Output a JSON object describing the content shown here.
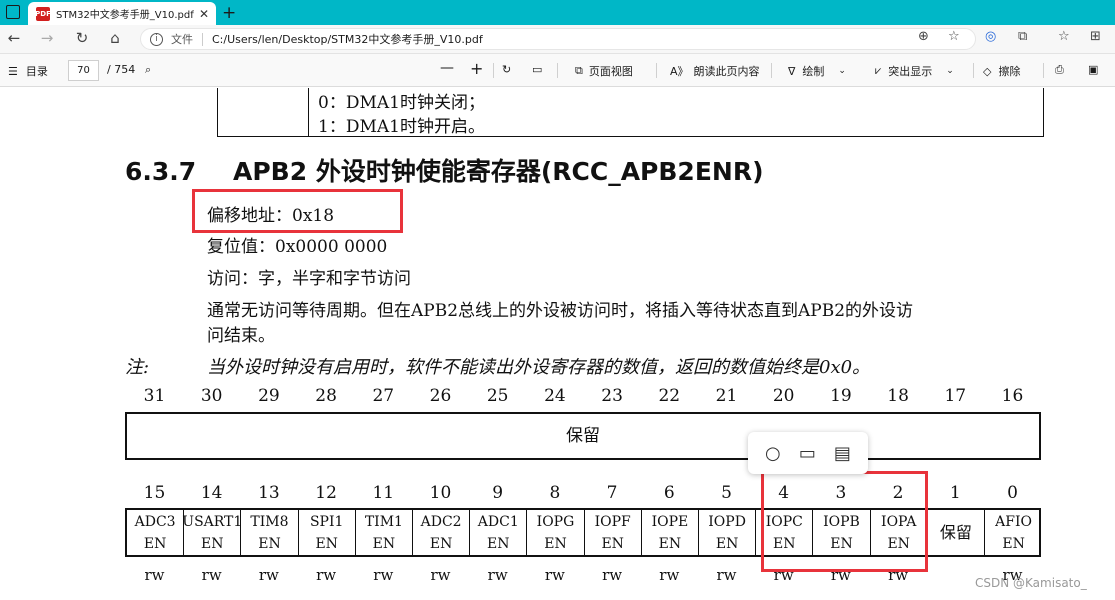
{
  "browser": {
    "tab_title": "STM32中文参考手册_V10.pdf",
    "tab_close": "✕",
    "new_tab": "+",
    "protocol_label": "文件",
    "url": "C:/Users/len/Desktop/STM32中文参考手册_V10.pdf"
  },
  "pdf_toolbar": {
    "toc_label": "目录",
    "page_current": "70",
    "page_total": "/ 754",
    "page_view_label": "页面视图",
    "read_aloud_label": "朗读此页内容",
    "draw_label": "绘制",
    "highlight_label": "突出显示",
    "erase_label": "擦除"
  },
  "document": {
    "prev_table_rows": [
      "0：DMA1时钟关闭；",
      "1：DMA1时钟开启。"
    ],
    "section_number": "6.3.7",
    "section_title": "APB2 外设时钟使能寄存器(RCC_APB2ENR)",
    "offset_line": "偏移地址：0x18",
    "reset_line": "复位值：0x0000 0000",
    "access_line": "访问：字，半字和字节访问",
    "wait_line_1": "通常无访问等待周期。但在APB2总线上的外设被访问时，将插入等待状态直到APB2的外设访",
    "wait_line_2": "问结束。",
    "note_label": "注:",
    "note_text": "当外设时钟没有启用时，软件不能读出外设寄存器的数值，返回的数值始终是0x0。"
  },
  "register": {
    "upper_bits": [
      "31",
      "30",
      "29",
      "28",
      "27",
      "26",
      "25",
      "24",
      "23",
      "22",
      "21",
      "20",
      "19",
      "18",
      "17",
      "16"
    ],
    "upper_field": "保留",
    "lower_bits": [
      "15",
      "14",
      "13",
      "12",
      "11",
      "10",
      "9",
      "8",
      "7",
      "6",
      "5",
      "4",
      "3",
      "2",
      "1",
      "0"
    ],
    "lower_fields": [
      {
        "l1": "ADC3",
        "l2": "EN"
      },
      {
        "l1": "USART1",
        "l2": "EN"
      },
      {
        "l1": "TIM8",
        "l2": "EN"
      },
      {
        "l1": "SPI1",
        "l2": "EN"
      },
      {
        "l1": "TIM1",
        "l2": "EN"
      },
      {
        "l1": "ADC2",
        "l2": "EN"
      },
      {
        "l1": "ADC1",
        "l2": "EN"
      },
      {
        "l1": "IOPG",
        "l2": "EN"
      },
      {
        "l1": "IOPF",
        "l2": "EN"
      },
      {
        "l1": "IOPE",
        "l2": "EN"
      },
      {
        "l1": "IOPD",
        "l2": "EN"
      },
      {
        "l1": "IOPC",
        "l2": "EN"
      },
      {
        "l1": "IOPB",
        "l2": "EN"
      },
      {
        "l1": "IOPA",
        "l2": "EN"
      },
      {
        "l1": "保留",
        "l2": ""
      },
      {
        "l1": "AFIO",
        "l2": "EN"
      }
    ],
    "access": [
      "rw",
      "rw",
      "rw",
      "rw",
      "rw",
      "rw",
      "rw",
      "rw",
      "rw",
      "rw",
      "rw",
      "rw",
      "rw",
      "rw",
      "",
      "rw"
    ]
  },
  "watermark": "CSDN @Kamisato_",
  "colors": {
    "tabbar": "#00b7c7",
    "annotation_red": "#e8333b"
  }
}
